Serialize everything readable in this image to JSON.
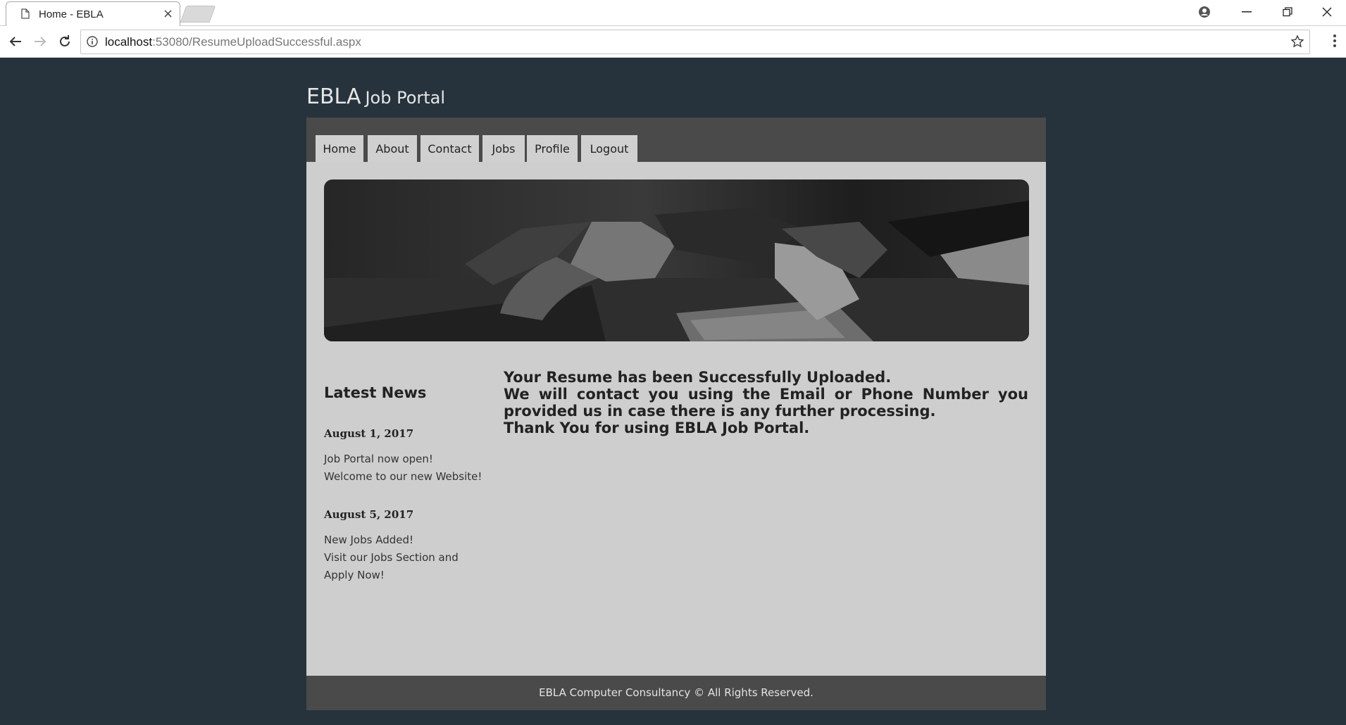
{
  "browser": {
    "tab_title": "Home - EBLA",
    "tab_close": "×",
    "url_host": "localhost",
    "url_path": ":53080/ResumeUploadSuccessful.aspx"
  },
  "site": {
    "brand": "EBLA",
    "subtitle": "Job Portal"
  },
  "nav": {
    "items": [
      {
        "label": "Home"
      },
      {
        "label": "About"
      },
      {
        "label": "Contact"
      },
      {
        "label": "Jobs"
      },
      {
        "label": "Profile"
      },
      {
        "label": "Logout"
      }
    ]
  },
  "sidebar": {
    "title": "Latest News",
    "news": [
      {
        "date": "August 1, 2017",
        "line1": "Job Portal now open!",
        "line2": "Welcome to our new Website!"
      },
      {
        "date": "August 5, 2017",
        "line1": "New Jobs Added!",
        "line2": "Visit our Jobs Section and",
        "line3": "Apply Now!"
      }
    ]
  },
  "main": {
    "line1": "Your Resume has been Successfully Uploaded.",
    "line2": "We will contact you using the Email or Phone Number you provided us in case there is any further processing.",
    "line3": "Thank You for using EBLA Job Portal."
  },
  "footer": {
    "text": "EBLA Computer Consultancy © All Rights Reserved."
  }
}
